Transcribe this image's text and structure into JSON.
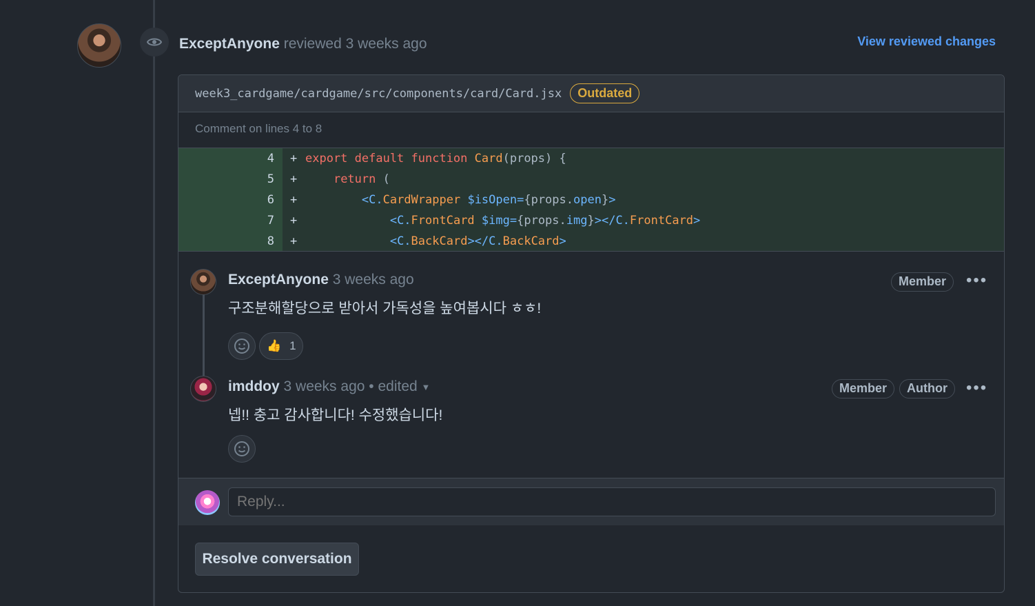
{
  "review": {
    "author": "ExceptAnyone",
    "action": "reviewed",
    "time": "3 weeks ago",
    "view_link": "View reviewed changes",
    "file_path": "week3_cardgame/cardgame/src/components/card/Card.jsx",
    "file_status": "Outdated",
    "comment_range": "Comment on lines 4 to 8",
    "code_lines": [
      {
        "number": "4",
        "sign": "+",
        "code": "export default function Card(props) {"
      },
      {
        "number": "5",
        "sign": "+",
        "code": "    return ("
      },
      {
        "number": "6",
        "sign": "+",
        "code": "        <C.CardWrapper $isOpen={props.open}>"
      },
      {
        "number": "7",
        "sign": "+",
        "code": "            <C.FrontCard $img={props.img}></C.FrontCard>"
      },
      {
        "number": "8",
        "sign": "+",
        "code": "            <C.BackCard></C.BackCard>"
      }
    ]
  },
  "comments": [
    {
      "author": "ExceptAnyone",
      "time": "3 weeks ago",
      "badges": [
        "Member"
      ],
      "text": "구조분해할당으로 받아서 가독성을 높여봅시다 ㅎㅎ!",
      "reaction": {
        "emoji": "👍",
        "count": "1"
      }
    },
    {
      "author": "imddoy",
      "time": "3 weeks ago",
      "edited": "• edited",
      "badges": [
        "Member",
        "Author"
      ],
      "text": "넵!! 충고 감사합니다! 수정했습니다!"
    }
  ],
  "reply": {
    "placeholder": "Reply..."
  },
  "actions": {
    "resolve": "Resolve conversation",
    "more": "•••"
  }
}
